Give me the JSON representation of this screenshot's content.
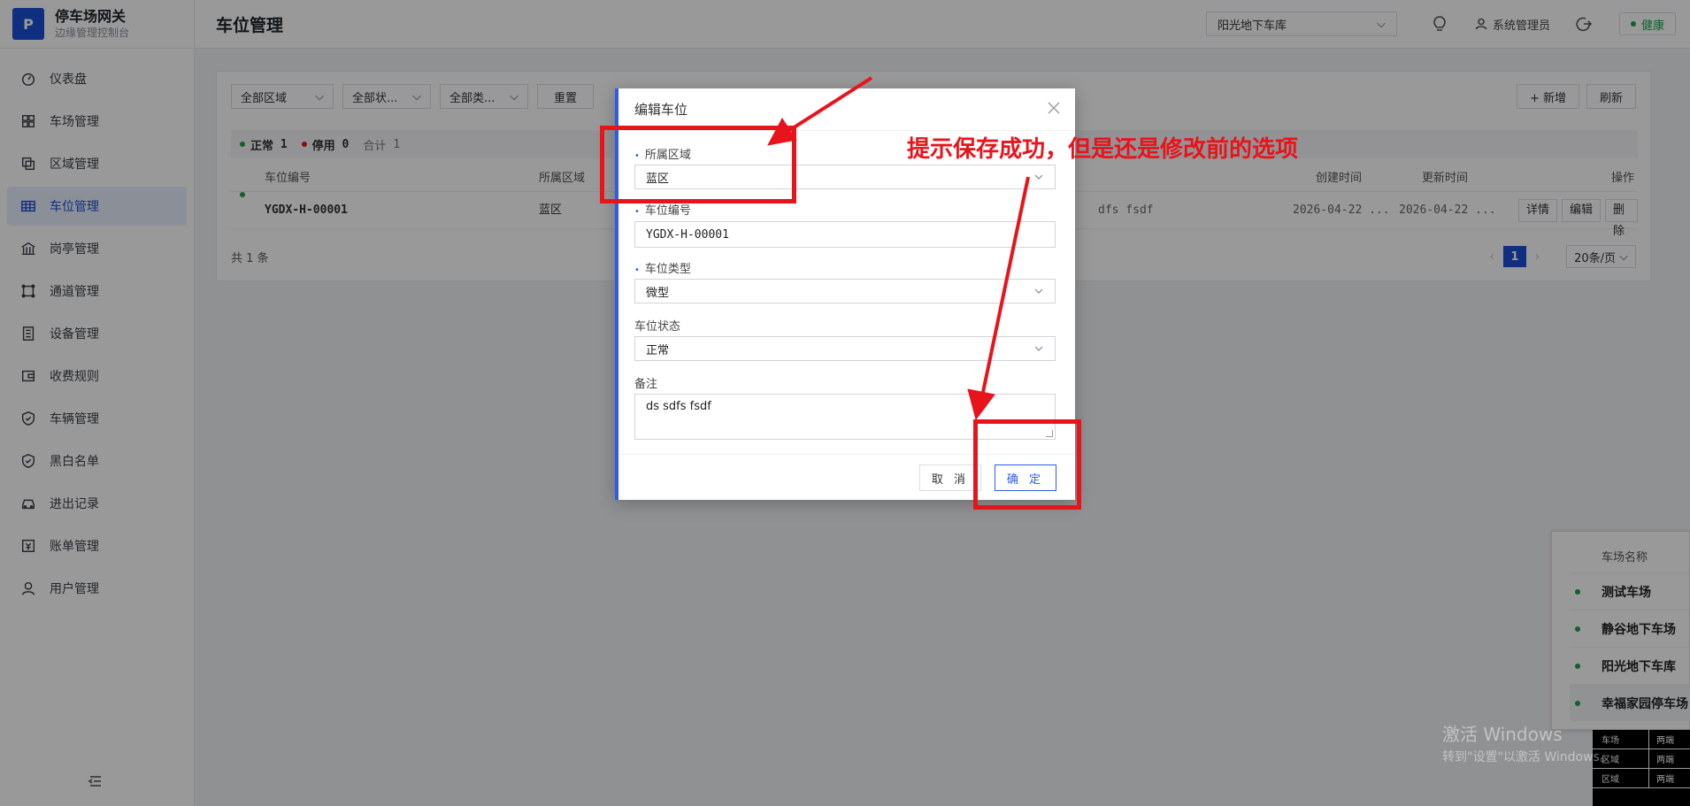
{
  "brand": {
    "logo": "P",
    "title": "停车场网关",
    "subtitle": "边缘管理控制台"
  },
  "sidebar": {
    "items": [
      {
        "label": "仪表盘",
        "icon": "dashboard-icon"
      },
      {
        "label": "车场管理",
        "icon": "grid-icon"
      },
      {
        "label": "区域管理",
        "icon": "layers-icon"
      },
      {
        "label": "车位管理",
        "icon": "table-icon",
        "active": true
      },
      {
        "label": "岗亭管理",
        "icon": "building-icon"
      },
      {
        "label": "通道管理",
        "icon": "channel-icon"
      },
      {
        "label": "设备管理",
        "icon": "device-icon"
      },
      {
        "label": "收费规则",
        "icon": "wallet-icon"
      },
      {
        "label": "车辆管理",
        "icon": "shield-icon"
      },
      {
        "label": "黑白名单",
        "icon": "shield-check-icon"
      },
      {
        "label": "进出记录",
        "icon": "car-icon"
      },
      {
        "label": "账单管理",
        "icon": "bill-icon"
      },
      {
        "label": "用户管理",
        "icon": "user-icon"
      }
    ]
  },
  "header": {
    "title": "车位管理",
    "lot_select": "阳光地下车库",
    "user": "系统管理员",
    "health": "健康"
  },
  "filters": {
    "area": "全部区域",
    "status": "全部状...",
    "type": "全部类...",
    "reset": "重置",
    "add": "+ 新增",
    "refresh": "刷新"
  },
  "summary": {
    "normal_label": "正常",
    "normal_count": "1",
    "disabled_label": "停用",
    "disabled_count": "0",
    "total_label": "合计",
    "total_count": "1"
  },
  "table": {
    "columns": [
      "车位编号",
      "所属区域",
      "创建时间",
      "更新时间",
      "操作"
    ],
    "rows": [
      {
        "code": "YGDX-H-00001",
        "area": "蓝区",
        "remark_partial": "dfs fsdf",
        "created": "2026-04-22 ...",
        "updated": "2026-04-22 ...",
        "actions": [
          "详情",
          "编辑",
          "删除"
        ]
      }
    ],
    "total": "共 1 条",
    "page": "1",
    "page_size": "20条/页"
  },
  "modal": {
    "title": "编辑车位",
    "area_label": "所属区域",
    "area_value": "蓝区",
    "code_label": "车位编号",
    "code_value": "YGDX-H-00001",
    "type_label": "车位类型",
    "type_value": "微型",
    "status_label": "车位状态",
    "status_value": "正常",
    "remark_label": "备注",
    "remark_value": "ds sdfs fsdf",
    "cancel": "取 消",
    "ok": "确 定"
  },
  "popup": {
    "header": "车场名称",
    "items": [
      "测试车场",
      "静谷地下车场",
      "阳光地下车库",
      "幸福家园停车场"
    ]
  },
  "table_fragment": {
    "rows": [
      {
        "a": "车场",
        "b": "两端"
      },
      {
        "a": "区域",
        "b": "两端"
      },
      {
        "a": "区域",
        "b": "两端"
      }
    ]
  },
  "watermark": {
    "line1": "激活 Windows",
    "line2": "转到\"设置\"以激活 Windows。"
  },
  "annotation": {
    "text": "提示保存成功，但是还是修改前的选项",
    "color": "#e8141c"
  },
  "colors": {
    "primary": "#1d4fd8",
    "success": "#1aa34a",
    "danger": "#e8141c"
  }
}
